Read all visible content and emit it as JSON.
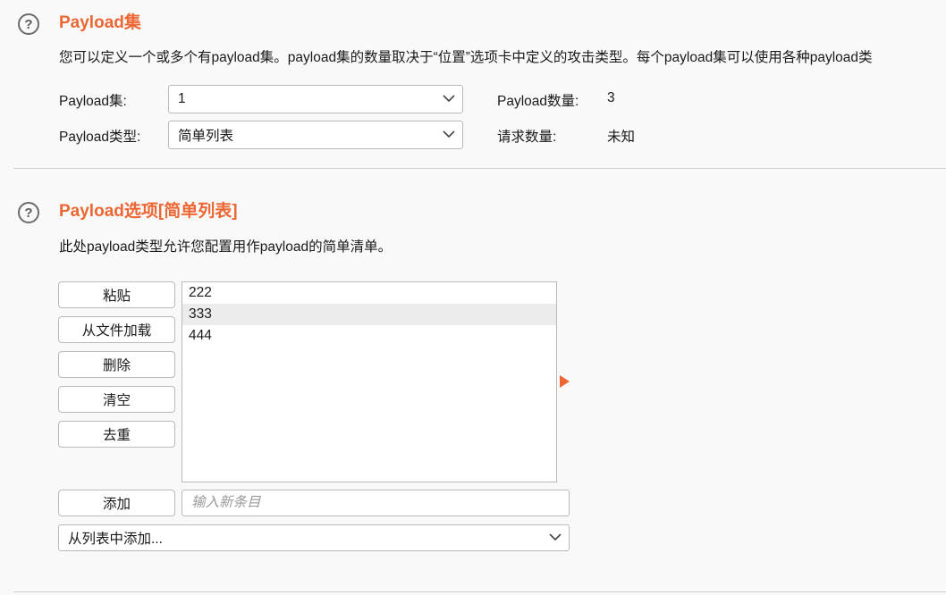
{
  "payload_sets": {
    "help_icon": "question-circle-icon",
    "title": "Payload集",
    "description": "您可以定义一个或多个有payload集。payload集的数量取决于“位置”选项卡中定义的攻击类型。每个payload集可以使用各种payload类",
    "set_label": "Payload集:",
    "set_value": "1",
    "type_label": "Payload类型:",
    "type_value": "简单列表",
    "count_label": "Payload数量:",
    "count_value": "3",
    "requests_label": "请求数量:",
    "requests_value": "未知"
  },
  "payload_options": {
    "help_icon": "question-circle-icon",
    "title": "Payload选项[简单列表]",
    "description": "此处payload类型允许您配置用作payload的简单清单。",
    "buttons": {
      "paste": "粘贴",
      "load": "从文件加载",
      "remove": "删除",
      "clear": "清空",
      "dedupe": "去重",
      "add": "添加"
    },
    "list_items": [
      "222",
      "333",
      "444"
    ],
    "selected_index": 1,
    "new_item_placeholder": "输入新条目",
    "new_item_value": "",
    "add_from_list_label": "从列表中添加..."
  },
  "colors": {
    "accent": "#ec6734",
    "background": "#f9f9f9",
    "border": "#b9b9b9"
  }
}
